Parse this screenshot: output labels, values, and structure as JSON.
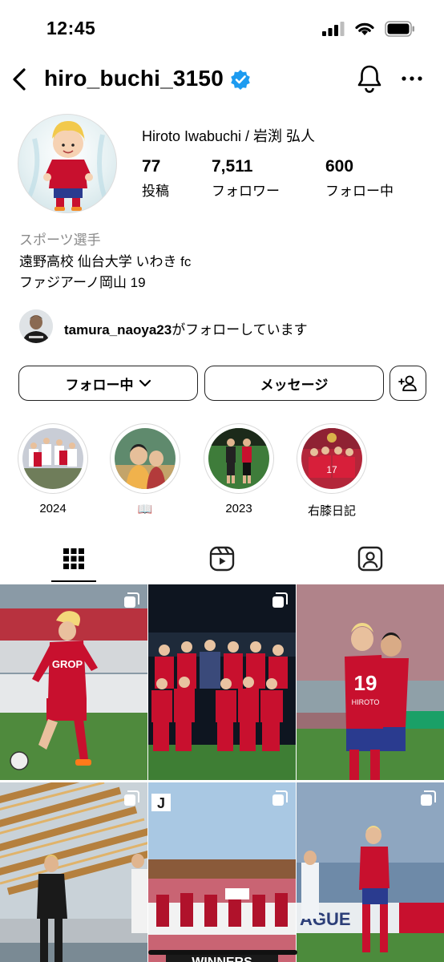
{
  "status_bar": {
    "time": "12:45"
  },
  "header": {
    "username": "hiro_buchi_3150"
  },
  "profile": {
    "full_name": "Hiroto Iwabuchi / 岩渕 弘人",
    "stats": {
      "posts": {
        "value": "77",
        "label": "投稿"
      },
      "followers": {
        "value": "7,511",
        "label": "フォロワー"
      },
      "following": {
        "value": "600",
        "label": "フォロー中"
      }
    },
    "category": "スポーツ選手",
    "bio": [
      "遠野高校 仙台大学 いわき fc",
      "ファジアーノ岡山 19"
    ]
  },
  "mutual": {
    "username": "tamura_naoya23",
    "text": "がフォローしています"
  },
  "buttons": {
    "following_label": "フォロー中",
    "message_label": "メッセージ"
  },
  "highlights": [
    {
      "label": "2024"
    },
    {
      "label": "📖"
    },
    {
      "label": "2023"
    },
    {
      "label": "右膝日記"
    }
  ],
  "tabs": [
    "grid-icon",
    "reels-icon",
    "tagged-icon"
  ],
  "grid": {
    "tiles": [
      {
        "caption_text": "GROP"
      },
      {
        "caption_text": ""
      },
      {
        "caption_text": "HIROTO"
      },
      {
        "caption_text": ""
      },
      {
        "caption_text": "WINNERS"
      },
      {
        "caption_text": "AGUE"
      }
    ]
  },
  "colors": {
    "accent_blue": "#1d9bf0",
    "jersey_red": "#c8102e",
    "text_gray": "#8a8a8a"
  }
}
